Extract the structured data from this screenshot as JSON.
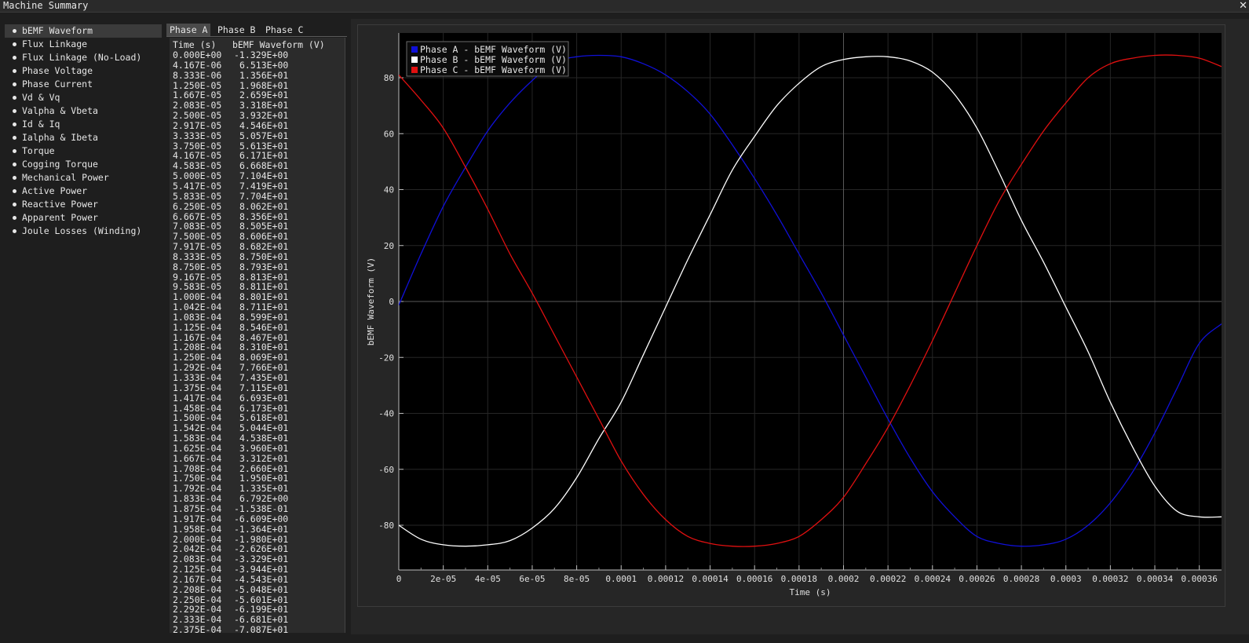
{
  "window": {
    "title": "Machine Summary",
    "close_glyph": "✕"
  },
  "sidebar": {
    "items": [
      {
        "label": "bEMF Waveform",
        "selected": true
      },
      {
        "label": "Flux Linkage"
      },
      {
        "label": "Flux Linkage (No-Load)"
      },
      {
        "label": "Phase Voltage"
      },
      {
        "label": "Phase Current"
      },
      {
        "label": "Vd & Vq"
      },
      {
        "label": "Valpha & Vbeta"
      },
      {
        "label": "Id & Iq"
      },
      {
        "label": "Ialpha & Ibeta"
      },
      {
        "label": "Torque"
      },
      {
        "label": "Cogging Torque"
      },
      {
        "label": "Mechanical Power"
      },
      {
        "label": "Active Power"
      },
      {
        "label": "Reactive Power"
      },
      {
        "label": "Apparent Power"
      },
      {
        "label": "Joule Losses (Winding)"
      }
    ]
  },
  "tabs": [
    {
      "label": "Phase A",
      "selected": true
    },
    {
      "label": "Phase B"
    },
    {
      "label": "Phase C"
    }
  ],
  "table": {
    "headers": [
      "Time (s)",
      "bEMF Waveform (V)"
    ],
    "rows": [
      [
        "0.000E+00",
        "-1.329E+00"
      ],
      [
        "4.167E-06",
        "6.513E+00"
      ],
      [
        "8.333E-06",
        "1.356E+01"
      ],
      [
        "1.250E-05",
        "1.968E+01"
      ],
      [
        "1.667E-05",
        "2.659E+01"
      ],
      [
        "2.083E-05",
        "3.318E+01"
      ],
      [
        "2.500E-05",
        "3.932E+01"
      ],
      [
        "2.917E-05",
        "4.546E+01"
      ],
      [
        "3.333E-05",
        "5.057E+01"
      ],
      [
        "3.750E-05",
        "5.613E+01"
      ],
      [
        "4.167E-05",
        "6.171E+01"
      ],
      [
        "4.583E-05",
        "6.668E+01"
      ],
      [
        "5.000E-05",
        "7.104E+01"
      ],
      [
        "5.417E-05",
        "7.419E+01"
      ],
      [
        "5.833E-05",
        "7.704E+01"
      ],
      [
        "6.250E-05",
        "8.062E+01"
      ],
      [
        "6.667E-05",
        "8.356E+01"
      ],
      [
        "7.083E-05",
        "8.505E+01"
      ],
      [
        "7.500E-05",
        "8.606E+01"
      ],
      [
        "7.917E-05",
        "8.682E+01"
      ],
      [
        "8.333E-05",
        "8.750E+01"
      ],
      [
        "8.750E-05",
        "8.793E+01"
      ],
      [
        "9.167E-05",
        "8.813E+01"
      ],
      [
        "9.583E-05",
        "8.811E+01"
      ],
      [
        "1.000E-04",
        "8.801E+01"
      ],
      [
        "1.042E-04",
        "8.711E+01"
      ],
      [
        "1.083E-04",
        "8.599E+01"
      ],
      [
        "1.125E-04",
        "8.546E+01"
      ],
      [
        "1.167E-04",
        "8.467E+01"
      ],
      [
        "1.208E-04",
        "8.310E+01"
      ],
      [
        "1.250E-04",
        "8.069E+01"
      ],
      [
        "1.292E-04",
        "7.766E+01"
      ],
      [
        "1.333E-04",
        "7.435E+01"
      ],
      [
        "1.375E-04",
        "7.115E+01"
      ],
      [
        "1.417E-04",
        "6.693E+01"
      ],
      [
        "1.458E-04",
        "6.173E+01"
      ],
      [
        "1.500E-04",
        "5.618E+01"
      ],
      [
        "1.542E-04",
        "5.044E+01"
      ],
      [
        "1.583E-04",
        "4.538E+01"
      ],
      [
        "1.625E-04",
        "3.960E+01"
      ],
      [
        "1.667E-04",
        "3.312E+01"
      ],
      [
        "1.708E-04",
        "2.660E+01"
      ],
      [
        "1.750E-04",
        "1.950E+01"
      ],
      [
        "1.792E-04",
        "1.335E+01"
      ],
      [
        "1.833E-04",
        "6.792E+00"
      ],
      [
        "1.875E-04",
        "-1.538E-01"
      ],
      [
        "1.917E-04",
        "-6.609E+00"
      ],
      [
        "1.958E-04",
        "-1.364E+01"
      ],
      [
        "2.000E-04",
        "-1.980E+01"
      ],
      [
        "2.042E-04",
        "-2.626E+01"
      ],
      [
        "2.083E-04",
        "-3.329E+01"
      ],
      [
        "2.125E-04",
        "-3.944E+01"
      ],
      [
        "2.167E-04",
        "-4.543E+01"
      ],
      [
        "2.208E-04",
        "-5.048E+01"
      ],
      [
        "2.250E-04",
        "-5.601E+01"
      ],
      [
        "2.292E-04",
        "-6.199E+01"
      ],
      [
        "2.333E-04",
        "-6.681E+01"
      ],
      [
        "2.375E-04",
        "-7.087E+01"
      ]
    ]
  },
  "chart_data": {
    "type": "line",
    "title": "",
    "xlabel": "Time (s)",
    "ylabel": "bEMF Waveform (V)",
    "xlim": [
      0,
      0.00037
    ],
    "ylim": [
      -96,
      96
    ],
    "x_ticks": [
      "0",
      "2e-05",
      "4e-05",
      "6e-05",
      "8e-05",
      "0.0001",
      "0.00012",
      "0.00014",
      "0.00016",
      "0.00018",
      "0.0002",
      "0.00022",
      "0.00024",
      "0.00026",
      "0.00028",
      "0.0003",
      "0.00032",
      "0.00034",
      "0.00036"
    ],
    "x_tick_values": [
      0,
      2e-05,
      4e-05,
      6e-05,
      8e-05,
      0.0001,
      0.00012,
      0.00014,
      0.00016,
      0.00018,
      0.0002,
      0.00022,
      0.00024,
      0.00026,
      0.00028,
      0.0003,
      0.00032,
      0.00034,
      0.00036
    ],
    "y_ticks": [
      80,
      60,
      40,
      20,
      0,
      -20,
      -40,
      -60,
      -80
    ],
    "grid": true,
    "legend_position": "top-left",
    "series": [
      {
        "name": "Phase A - bEMF Waveform (V)",
        "color": "#1010d8",
        "x": [
          0,
          1e-05,
          2e-05,
          3e-05,
          4e-05,
          5e-05,
          6e-05,
          7e-05,
          8e-05,
          9e-05,
          0.0001,
          0.00011,
          0.00012,
          0.00013,
          0.00014,
          0.00015,
          0.00016,
          0.00017,
          0.00018,
          0.00019,
          0.0002,
          0.00021,
          0.00022,
          0.00023,
          0.00024,
          0.00025,
          0.00026,
          0.00027,
          0.00028,
          0.00029,
          0.0003,
          0.00031,
          0.00032,
          0.00033,
          0.00034,
          0.00035,
          0.00036,
          0.00037
        ],
        "values": [
          -1.3,
          17,
          34,
          48,
          61,
          71,
          79,
          85.5,
          87.5,
          88,
          87.5,
          85,
          81,
          75,
          67,
          56,
          44,
          31,
          17,
          3,
          -12,
          -27,
          -42,
          -56,
          -68,
          -77,
          -84,
          -86.5,
          -87.5,
          -87,
          -85,
          -80,
          -72,
          -61,
          -47,
          -31,
          -15,
          -8
        ]
      },
      {
        "name": "Phase B - bEMF Waveform (V)",
        "color": "#ffffff",
        "x": [
          0,
          1e-05,
          2e-05,
          3e-05,
          4e-05,
          5e-05,
          6e-05,
          7e-05,
          8e-05,
          9e-05,
          0.0001,
          0.00011,
          0.00012,
          0.00013,
          0.00014,
          0.00015,
          0.00016,
          0.00017,
          0.00018,
          0.00019,
          0.0002,
          0.00021,
          0.00022,
          0.00023,
          0.00024,
          0.00025,
          0.00026,
          0.00027,
          0.00028,
          0.00029,
          0.0003,
          0.00031,
          0.00032,
          0.00033,
          0.00034,
          0.00035,
          0.00036,
          0.00037
        ],
        "values": [
          -80,
          -85,
          -87,
          -87.5,
          -87,
          -85.5,
          -81,
          -74,
          -63,
          -49,
          -36,
          -19,
          -2,
          15,
          31,
          47,
          59,
          70,
          78,
          84,
          86.5,
          87.5,
          87.5,
          86,
          82,
          74,
          62,
          46,
          29,
          14,
          -2,
          -18,
          -36,
          -52,
          -66,
          -75,
          -77,
          -77
        ]
      },
      {
        "name": "Phase C - bEMF Waveform (V)",
        "color": "#e01010",
        "x": [
          0,
          1e-05,
          2e-05,
          3e-05,
          4e-05,
          5e-05,
          6e-05,
          7e-05,
          8e-05,
          9e-05,
          0.0001,
          0.00011,
          0.00012,
          0.00013,
          0.00014,
          0.00015,
          0.00016,
          0.00017,
          0.00018,
          0.00019,
          0.0002,
          0.00021,
          0.00022,
          0.00023,
          0.00024,
          0.00025,
          0.00026,
          0.00027,
          0.00028,
          0.00029,
          0.0003,
          0.00031,
          0.00032,
          0.00033,
          0.00034,
          0.00035,
          0.00036,
          0.00037
        ],
        "values": [
          81,
          72,
          62,
          48,
          33,
          17,
          3,
          -12,
          -27,
          -42,
          -57,
          -69,
          -78,
          -84,
          -86.5,
          -87.5,
          -87.5,
          -86.5,
          -84,
          -78,
          -70,
          -58,
          -45,
          -30,
          -14,
          3,
          20,
          36,
          49,
          61,
          71,
          80,
          85,
          87,
          88,
          88,
          87,
          84
        ]
      }
    ]
  }
}
